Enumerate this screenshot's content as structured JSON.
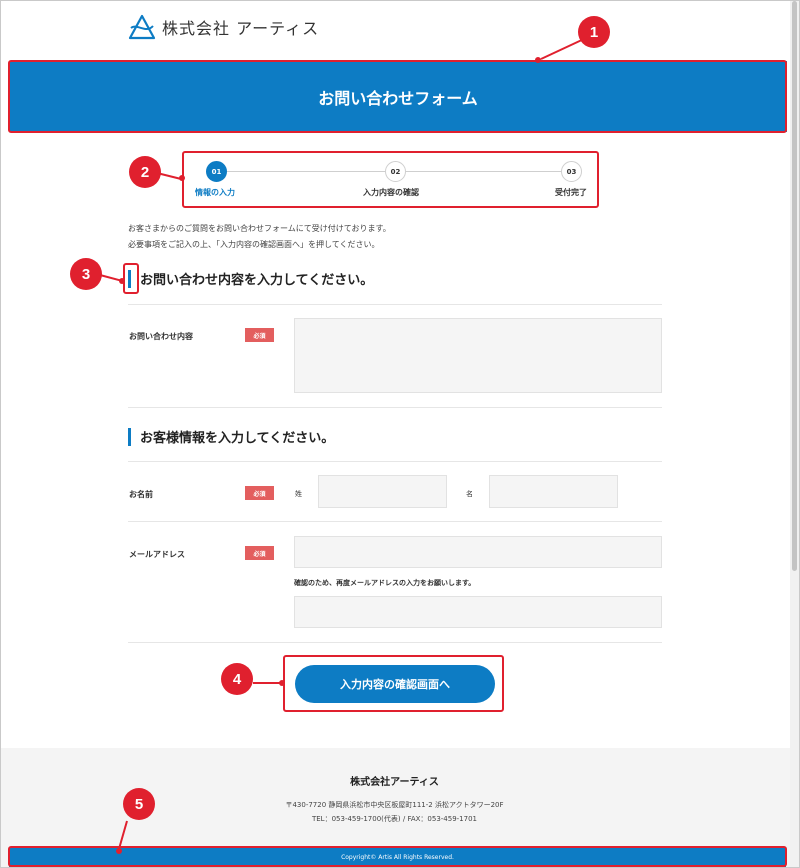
{
  "header": {
    "company_name": "株式会社 アーティス",
    "page_title": "お問い合わせフォーム"
  },
  "stepper": {
    "steps": [
      {
        "number": "01",
        "label": "情報の入力",
        "active": true
      },
      {
        "number": "02",
        "label": "入力内容の確認",
        "active": false
      },
      {
        "number": "03",
        "label": "受付完了",
        "active": false
      }
    ]
  },
  "intro": {
    "line1": "お客さまからのご質問をお問い合わせフォームにて受け付けております。",
    "line2": "必要事項をご記入の上、「入力内容の確認画面へ」を押してください。"
  },
  "inquiry_section": {
    "heading": "お問い合わせ内容を入力してください。",
    "field_label": "お問い合わせ内容",
    "required": "必須",
    "value": ""
  },
  "customer_section": {
    "heading": "お客様情報を入力してください。",
    "name_label": "お名前",
    "name_required": "必須",
    "last_name_label": "姓",
    "first_name_label": "名",
    "last_name_value": "",
    "first_name_value": "",
    "email_label": "メールアドレス",
    "email_required": "必須",
    "email_value": "",
    "email_confirm_note": "確認のため、再度メールアドレスの入力をお願いします。",
    "email_confirm_value": ""
  },
  "submit": {
    "label": "入力内容の確認画面へ"
  },
  "footer": {
    "company": "株式会社アーティス",
    "address": "〒430-7720 静岡県浜松市中央区板屋町111-2 浜松アクトタワー20F",
    "tel": "TEL：053-459-1700(代表) / FAX：053-459-1701",
    "copyright": "Copyright© Artis All Rights Reserved."
  },
  "annotations": [
    "1",
    "2",
    "3",
    "4",
    "5"
  ],
  "colors": {
    "brand_blue": "#0d7cc4",
    "annotation_red": "#e0202e",
    "required_badge": "#e35e5e"
  }
}
